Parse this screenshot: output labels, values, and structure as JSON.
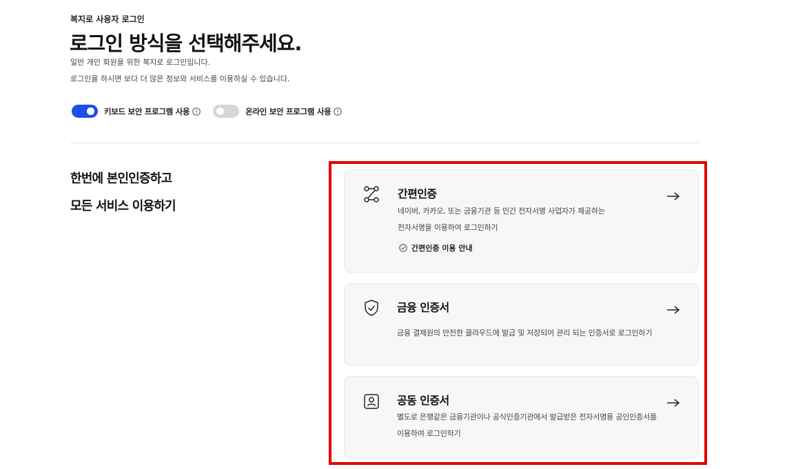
{
  "header": {
    "breadcrumb": "복지로 사용자 로그인",
    "title": "로그인 방식을 선택해주세요.",
    "desc1": "일반 개인 회원을 위한 복지로 로그인입니다.",
    "desc2": "로그인을 하시면 보다 더 많은 정보와 서비스를 이용하실 수 있습니다."
  },
  "toggles": [
    {
      "label": "키보드 보안 프로그램 사용",
      "on": true
    },
    {
      "label": "온라인 보안 프로그램 사용",
      "on": false
    }
  ],
  "side": {
    "line1": "한번에 본인인증하고",
    "line2": "모든 서비스 이용하기"
  },
  "cards": [
    {
      "icon": "connection-icon",
      "title": "간편인증",
      "desc_line1": "네이버, 카카오, 또는 금융기관 등 민간 전자서명 사업자가 제공하는",
      "desc_line2": "전자서명을 이용하여 로그인하기",
      "guide_label": "간편인증 이용 안내"
    },
    {
      "icon": "shield-check-icon",
      "title": "금융 인증서",
      "desc_line1": "금융 결제원의 안전한 클라우드에 발급 및 저장되어 관리 되는 인증서로 로그인하기"
    },
    {
      "icon": "user-id-icon",
      "title": "공동 인증서",
      "desc_line1": "별도로 은행같은 금융기관이나 공식인증기관에서 발급받은 전자서명용 공인인증서를",
      "desc_line2": "이용하여 로그인하기"
    }
  ],
  "colors": {
    "accent": "#1d4ee8",
    "highlight": "#e50000",
    "card_bg": "#f7f7f7"
  }
}
